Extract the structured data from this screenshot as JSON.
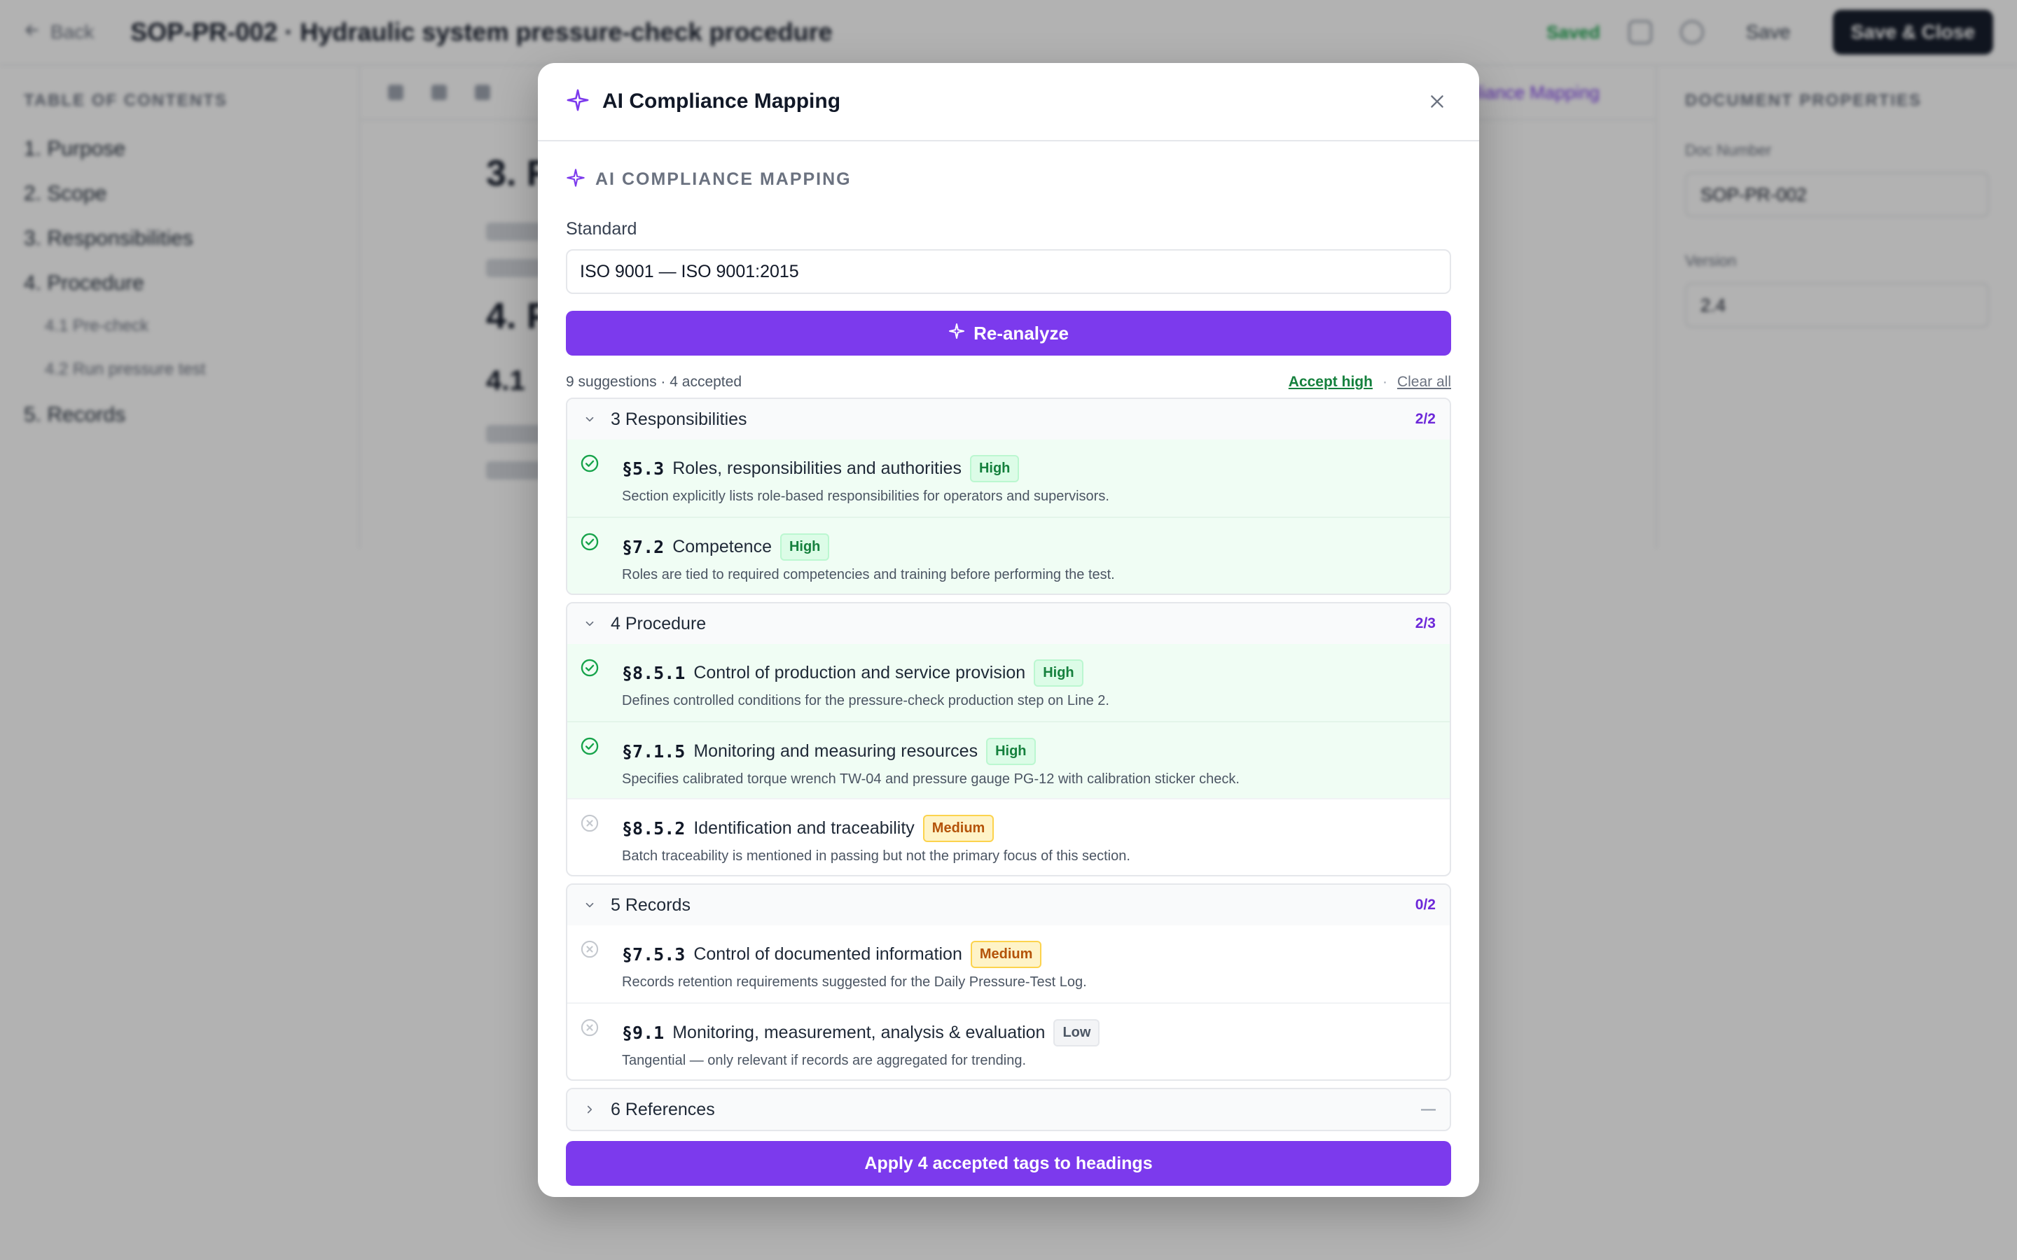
{
  "background": {
    "back_label": "Back",
    "doc_title": "SOP-PR-002 · Hydraulic system pressure-check procedure",
    "saved_label": "Saved",
    "save_label": "Save",
    "save_close_label": "Save & Close",
    "toc": {
      "heading": "TABLE OF CONTENTS",
      "items": [
        {
          "label": "1. Purpose"
        },
        {
          "label": "2. Scope"
        },
        {
          "label": "3. Responsibilities"
        },
        {
          "label": "4. Procedure"
        },
        {
          "label": "4.1 Pre-check"
        },
        {
          "label": "4.2 Run pressure test"
        },
        {
          "label": "5. Records"
        }
      ]
    },
    "editor": {
      "link_label": "Compliance Mapping",
      "heading_1": "3. R",
      "heading_2": "4. P",
      "heading_3": "4.1"
    },
    "properties": {
      "heading": "DOCUMENT PROPERTIES",
      "doc_number_label": "Doc Number",
      "doc_number_value": "SOP-PR-002",
      "version_label": "Version",
      "version_value": "2.4"
    }
  },
  "modal": {
    "title": "AI Compliance Mapping",
    "section_label": "AI COMPLIANCE MAPPING",
    "standard_label": "Standard",
    "standard_value": "ISO 9001 — ISO 9001:2015",
    "reanalyze_label": "Re-analyze",
    "summary": "9 suggestions · 4 accepted",
    "accept_high_label": "Accept high",
    "separator": "·",
    "clear_all_label": "Clear all",
    "groups": [
      {
        "title": "3 Responsibilities",
        "count": "2/2",
        "suggestions": [
          {
            "clause": "§5.3",
            "title": "Roles, responsibilities and authorities",
            "confidence": "High",
            "description": "Section explicitly lists role-based responsibilities for operators and supervisors.",
            "accepted": true
          },
          {
            "clause": "§7.2",
            "title": "Competence",
            "confidence": "High",
            "description": "Roles are tied to required competencies and training before performing the test.",
            "accepted": true
          }
        ]
      },
      {
        "title": "4 Procedure",
        "count": "2/3",
        "suggestions": [
          {
            "clause": "§8.5.1",
            "title": "Control of production and service provision",
            "confidence": "High",
            "description": "Defines controlled conditions for the pressure-check production step on Line 2.",
            "accepted": true
          },
          {
            "clause": "§7.1.5",
            "title": "Monitoring and measuring resources",
            "confidence": "High",
            "description": "Specifies calibrated torque wrench TW-04 and pressure gauge PG-12 with calibration sticker check.",
            "accepted": true
          },
          {
            "clause": "§8.5.2",
            "title": "Identification and traceability",
            "confidence": "Medium",
            "description": "Batch traceability is mentioned in passing but not the primary focus of this section.",
            "accepted": false
          }
        ]
      },
      {
        "title": "5 Records",
        "count": "0/2",
        "suggestions": [
          {
            "clause": "§7.5.3",
            "title": "Control of documented information",
            "confidence": "Medium",
            "description": "Records retention requirements suggested for the Daily Pressure-Test Log.",
            "accepted": false
          },
          {
            "clause": "§9.1",
            "title": "Monitoring, measurement, analysis & evaluation",
            "confidence": "Low",
            "description": "Tangential — only relevant if records are aggregated for trending.",
            "accepted": false
          }
        ]
      },
      {
        "title": "6 References",
        "count": "—",
        "suggestions": []
      }
    ],
    "apply_label": "Apply 4 accepted tags to headings"
  },
  "colors": {
    "accent": "#7c3aed",
    "accepted_bg": "#f0fdf4",
    "high": "#15803d",
    "medium": "#b45309"
  }
}
